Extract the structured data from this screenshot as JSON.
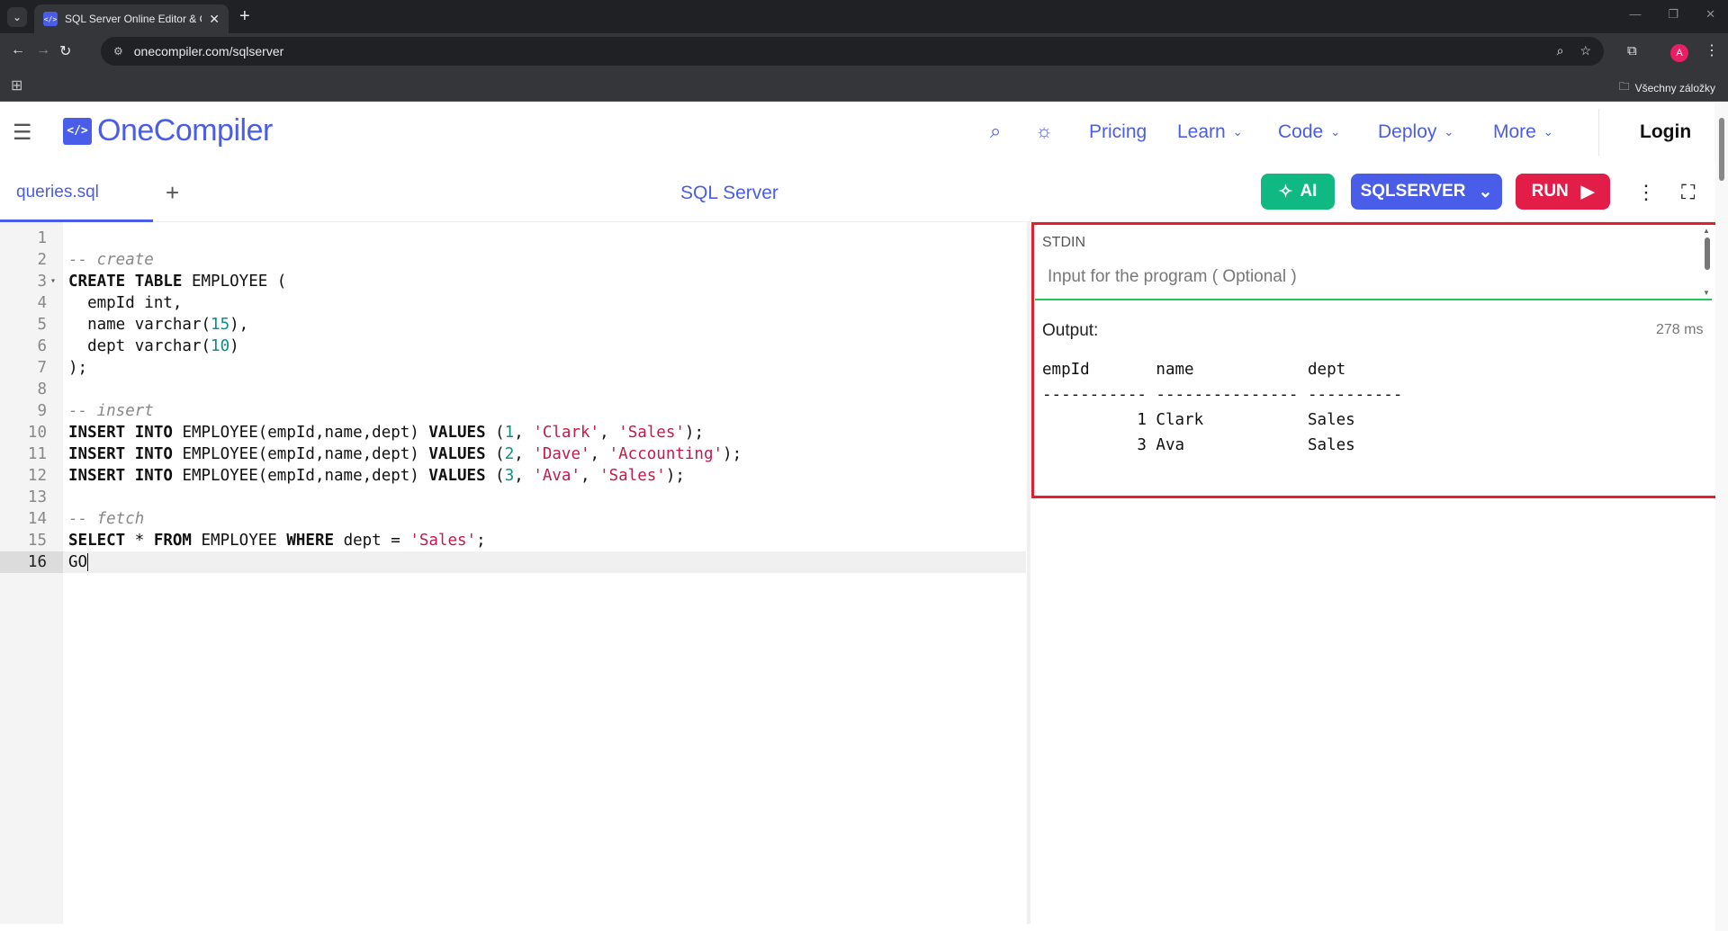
{
  "browser": {
    "tab_title": "SQL Server Online Editor & Compiler",
    "url": "onecompiler.com/sqlserver",
    "bookmarks_label": "Všechny záložky",
    "profile_initial": "A"
  },
  "header": {
    "logo_mark": "</>",
    "logo_text": "OneCompiler",
    "nav": [
      {
        "label": "Pricing",
        "dropdown": false
      },
      {
        "label": "Learn",
        "dropdown": true
      },
      {
        "label": "Code",
        "dropdown": true
      },
      {
        "label": "Deploy",
        "dropdown": true
      },
      {
        "label": "More",
        "dropdown": true
      }
    ],
    "login": "Login"
  },
  "toolbar": {
    "file_name": "queries.sql",
    "language_title": "SQL Server",
    "ai_label": "AI",
    "language_button": "SQLSERVER",
    "run_label": "RUN"
  },
  "editor": {
    "lines": [
      {
        "n": "1",
        "html": ""
      },
      {
        "n": "2",
        "html": "<span class='cm'>-- create</span>"
      },
      {
        "n": "3",
        "html": "<span class='kw'>CREATE TABLE</span> EMPLOYEE (",
        "fold": true
      },
      {
        "n": "4",
        "html": "  empId int,"
      },
      {
        "n": "5",
        "html": "  name varchar(<span class='nm'>15</span>),"
      },
      {
        "n": "6",
        "html": "  dept varchar(<span class='nm'>10</span>)"
      },
      {
        "n": "7",
        "html": ");"
      },
      {
        "n": "8",
        "html": ""
      },
      {
        "n": "9",
        "html": "<span class='cm'>-- insert</span>"
      },
      {
        "n": "10",
        "html": "<span class='kw'>INSERT INTO</span> EMPLOYEE(empId,name,dept) <span class='kw'>VALUES</span> (<span class='nm'>1</span>, <span class='st'>'Clark'</span>, <span class='st'>'Sales'</span>);"
      },
      {
        "n": "11",
        "html": "<span class='kw'>INSERT INTO</span> EMPLOYEE(empId,name,dept) <span class='kw'>VALUES</span> (<span class='nm'>2</span>, <span class='st'>'Dave'</span>, <span class='st'>'Accounting'</span>);"
      },
      {
        "n": "12",
        "html": "<span class='kw'>INSERT INTO</span> EMPLOYEE(empId,name,dept) <span class='kw'>VALUES</span> (<span class='nm'>3</span>, <span class='st'>'Ava'</span>, <span class='st'>'Sales'</span>);"
      },
      {
        "n": "13",
        "html": ""
      },
      {
        "n": "14",
        "html": "<span class='cm'>-- fetch</span>"
      },
      {
        "n": "15",
        "html": "<span class='kw'>SELECT</span> * <span class='kw'>FROM</span> EMPLOYEE <span class='kw'>WHERE</span> dept = <span class='st'>'Sales'</span>;"
      },
      {
        "n": "16",
        "html": "GO<span class='cursor'></span>",
        "active": true
      }
    ]
  },
  "io": {
    "stdin_label": "STDIN",
    "stdin_placeholder": "Input for the program ( Optional )",
    "output_label": "Output:",
    "exec_time": "278 ms",
    "output_lines": [
      "empId       name            dept",
      "----------- --------------- ----------",
      "          1 Clark           Sales",
      "          3 Ava             Sales"
    ]
  },
  "colors": {
    "brand": "#4a5de8",
    "ai_green": "#10b981",
    "run_red": "#e11d48",
    "highlight": "#e0202e"
  }
}
